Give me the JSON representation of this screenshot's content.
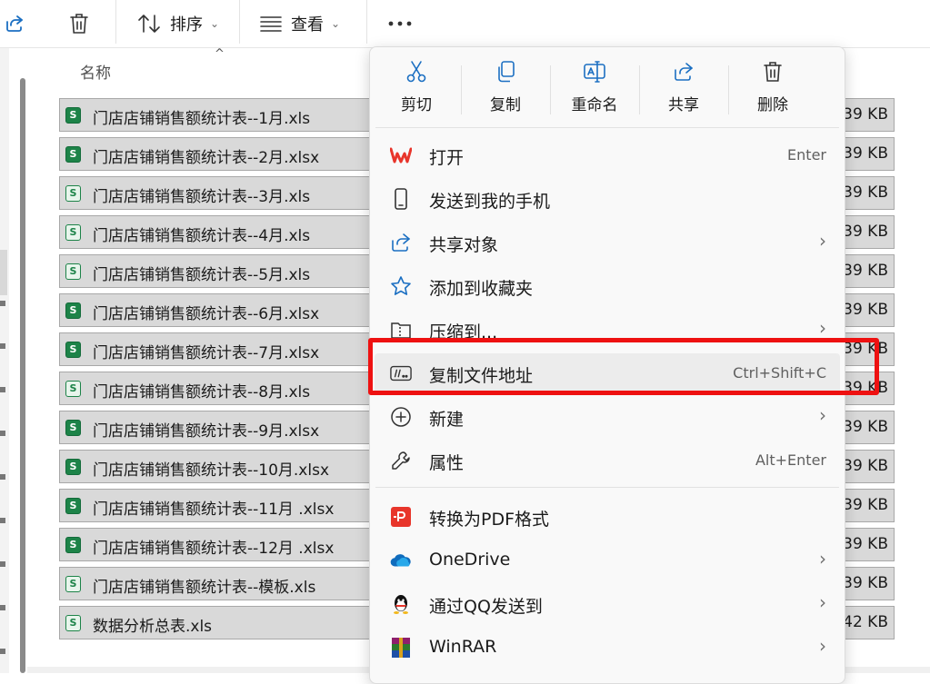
{
  "toolbar": {
    "sort_label": "排序",
    "view_label": "查看"
  },
  "file_list": {
    "name_header": "名称",
    "rows": [
      {
        "name": "门店店铺销售额统计表--1月.xls",
        "size": "39 KB"
      },
      {
        "name": "门店店铺销售额统计表--2月.xlsx",
        "size": "39 KB"
      },
      {
        "name": "门店店铺销售额统计表--3月.xls",
        "size": "39 KB"
      },
      {
        "name": "门店店铺销售额统计表--4月.xls",
        "size": "39 KB"
      },
      {
        "name": "门店店铺销售额统计表--5月.xls",
        "size": "39 KB"
      },
      {
        "name": "门店店铺销售额统计表--6月.xlsx",
        "size": "39 KB"
      },
      {
        "name": "门店店铺销售额统计表--7月.xlsx",
        "size": "39 KB"
      },
      {
        "name": "门店店铺销售额统计表--8月.xls",
        "size": "39 KB"
      },
      {
        "name": "门店店铺销售额统计表--9月.xlsx",
        "size": "39 KB"
      },
      {
        "name": "门店店铺销售额统计表--10月.xlsx",
        "size": "39 KB"
      },
      {
        "name": "门店店铺销售额统计表--11月 .xlsx",
        "size": "39 KB"
      },
      {
        "name": "门店店铺销售额统计表--12月 .xlsx",
        "size": "39 KB"
      },
      {
        "name": "门店店铺销售额统计表--模板.xls",
        "size": "39 KB"
      },
      {
        "name": "数据分析总表.xls",
        "size": "42 KB"
      }
    ]
  },
  "context_menu": {
    "quick_actions": [
      {
        "icon": "scissors-icon",
        "label": "剪切"
      },
      {
        "icon": "copy-icon",
        "label": "复制"
      },
      {
        "icon": "rename-icon",
        "label": "重命名"
      },
      {
        "icon": "share-icon",
        "label": "共享"
      },
      {
        "icon": "trash-icon",
        "label": "删除"
      }
    ],
    "items": [
      {
        "icon": "wps-icon",
        "label": "打开",
        "shortcut": "Enter"
      },
      {
        "icon": "phone-icon",
        "label": "发送到我的手机"
      },
      {
        "icon": "share-icon",
        "label": "共享对象",
        "submenu": true
      },
      {
        "icon": "star-icon",
        "label": "添加到收藏夹"
      },
      {
        "icon": "zip-folder-icon",
        "label": "压缩到...",
        "submenu": true
      },
      {
        "icon": "path-icon",
        "label": "复制文件地址",
        "shortcut": "Ctrl+Shift+C",
        "highlighted": true
      },
      {
        "icon": "plus-circle-icon",
        "label": "新建",
        "submenu": true
      },
      {
        "icon": "wrench-icon",
        "label": "属性",
        "shortcut": "Alt+Enter"
      },
      {
        "icon": "pdf-icon",
        "label": "转换为PDF格式"
      },
      {
        "icon": "onedrive-icon",
        "label": "OneDrive",
        "submenu": true
      },
      {
        "icon": "qq-icon",
        "label": "通过QQ发送到",
        "submenu": true
      },
      {
        "icon": "winrar-icon",
        "label": "WinRAR",
        "submenu": true
      }
    ],
    "submenu_arrow": "›"
  },
  "annotation": {
    "highlight_color": "#ee1111",
    "target_item": "复制文件地址"
  },
  "colors": {
    "excel_green": "#1d8348",
    "wps_red": "#e8352b",
    "selection_gray": "#d9d9d9"
  }
}
